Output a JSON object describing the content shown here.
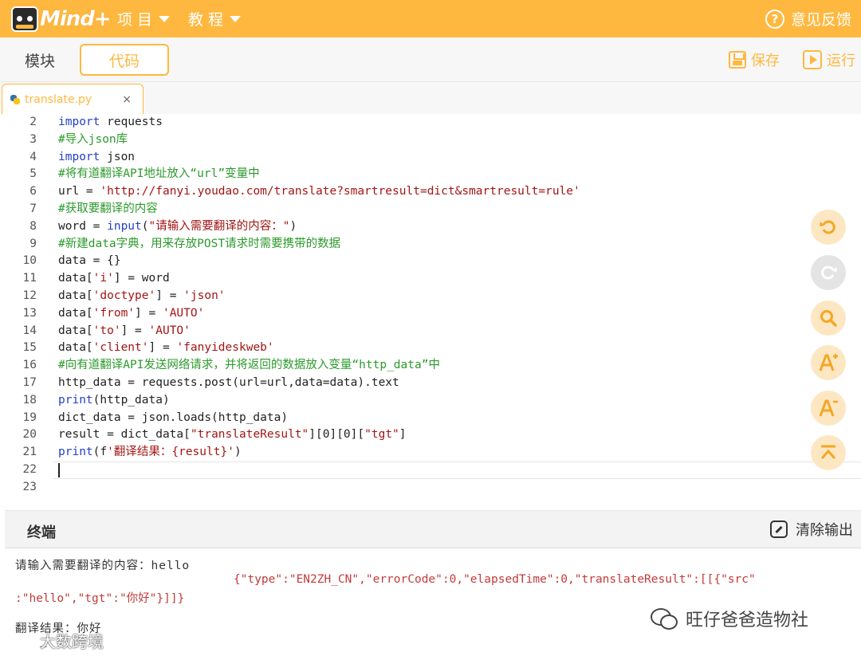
{
  "header": {
    "logo_text": "Mind+",
    "menu_project": "项 目",
    "menu_tutorial": "教 程",
    "feedback": "意见反馈"
  },
  "toolbar": {
    "tab_blocks": "模块",
    "tab_code": "代码",
    "save_label": "保存",
    "run_label": "运行"
  },
  "file_tab": {
    "name": "translate.py",
    "close": "×"
  },
  "editor": {
    "lines": [
      {
        "n": "2",
        "text": "import requests"
      },
      {
        "n": "3",
        "text": "#导入json库"
      },
      {
        "n": "4",
        "text": "import json"
      },
      {
        "n": "5",
        "text": "#将有道翻译API地址放入“url”变量中"
      },
      {
        "n": "6",
        "text": "url = 'http://fanyi.youdao.com/translate?smartresult=dict&smartresult=rule'"
      },
      {
        "n": "7",
        "text": "#获取要翻译的内容"
      },
      {
        "n": "8",
        "text": "word = input(\"请输入需要翻译的内容：\")"
      },
      {
        "n": "9",
        "text": "#新建data字典，用来存放POST请求时需要携带的数据"
      },
      {
        "n": "10",
        "text": "data = {}"
      },
      {
        "n": "11",
        "text": "data['i'] = word"
      },
      {
        "n": "12",
        "text": "data['doctype'] = 'json'"
      },
      {
        "n": "13",
        "text": "data['from'] = 'AUTO'"
      },
      {
        "n": "14",
        "text": "data['to'] = 'AUTO'"
      },
      {
        "n": "15",
        "text": "data['client'] = 'fanyideskweb'"
      },
      {
        "n": "16",
        "text": "#向有道翻译API发送网络请求，并将返回的数据放入变量“http_data”中"
      },
      {
        "n": "17",
        "text": "http_data = requests.post(url=url,data=data).text"
      },
      {
        "n": "18",
        "text": "print(http_data)"
      },
      {
        "n": "19",
        "text": "dict_data = json.loads(http_data)"
      },
      {
        "n": "20",
        "text": "result = dict_data[\"translateResult\"][0][0][\"tgt\"]"
      },
      {
        "n": "21",
        "text": "print(f'翻译结果：{result}')"
      },
      {
        "n": "22",
        "text": ""
      },
      {
        "n": "23",
        "text": ""
      }
    ]
  },
  "tools": {
    "undo_icon": "undo-icon",
    "redo_icon": "redo-icon",
    "search_icon": "search-icon",
    "font_larger_icon": "font-larger-icon",
    "font_smaller_icon": "font-smaller-icon",
    "scroll_top_icon": "scroll-top-icon"
  },
  "terminal": {
    "title": "终端",
    "clear_label": "清除输出",
    "prompt_line": "请输入需要翻译的内容：hello",
    "json_line_1": "{\"type\":\"EN2ZH_CN\",\"errorCode\":0,\"elapsedTime\":0,\"translateResult\":[[{\"src\"",
    "json_line_2": ":\"hello\",\"tgt\":\"你好\"}]]}",
    "result_line": "翻译结果：你好",
    "cursor": "_"
  },
  "watermarks": {
    "wechat_account": "旺仔爸爸造物社",
    "source": "大数跨境"
  },
  "colors": {
    "brand": "#ffb83f",
    "keyword": "#2440c9",
    "string": "#a31515",
    "comment": "#2b9a2b"
  }
}
